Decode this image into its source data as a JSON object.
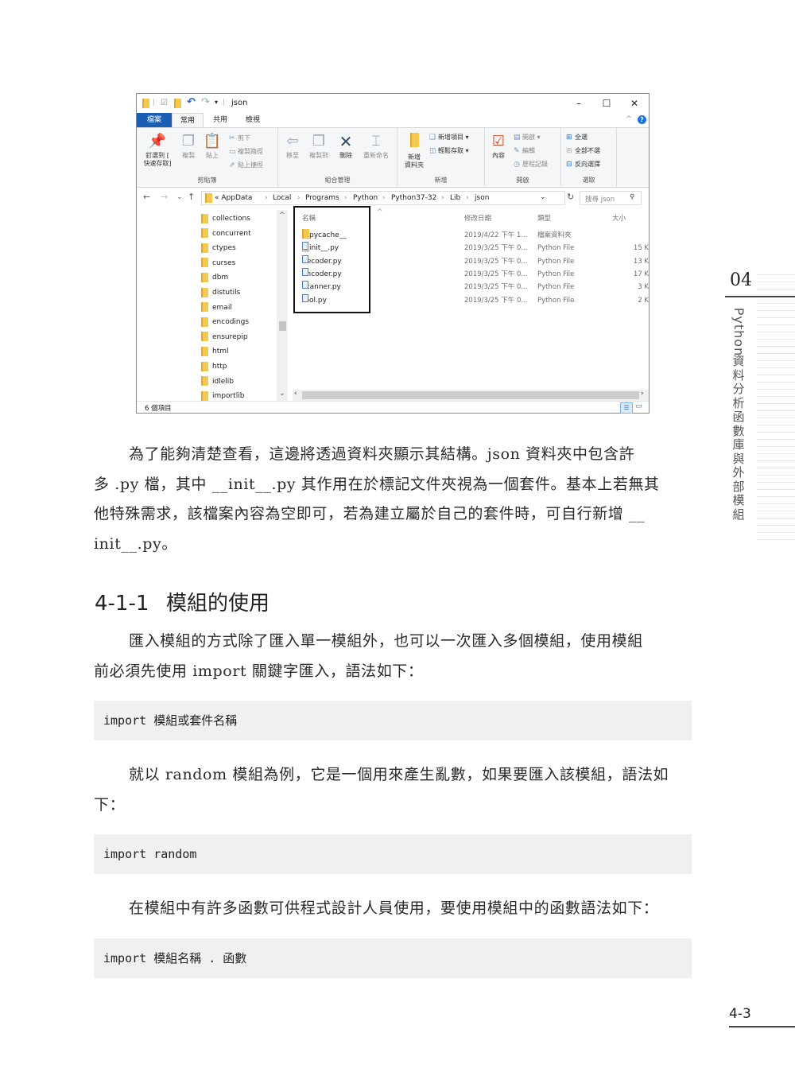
{
  "explorer": {
    "window_title": "json",
    "window_controls": {
      "minimize": "–",
      "maximize": "☐",
      "close": "✕"
    },
    "tabs": [
      {
        "label": "檔案",
        "active": false
      },
      {
        "label": "常用",
        "active": true
      },
      {
        "label": "共用",
        "active": false
      },
      {
        "label": "檢視",
        "active": false
      }
    ],
    "ribbon": {
      "clipboard": {
        "group_label": "剪貼簿",
        "pin_label_1": "釘選到 [",
        "pin_label_2": "快速存取]",
        "copy_label": "複製",
        "paste_label": "貼上",
        "cut_label": "剪下",
        "copy_path_label": "複製路徑",
        "paste_shortcut_label": "貼上捷徑"
      },
      "organize": {
        "group_label": "組合管理",
        "move_to_label": "移至",
        "copy_to_label": "複製到",
        "delete_label": "刪除",
        "rename_label": "重新命名"
      },
      "new": {
        "group_label": "新增",
        "new_folder_label_1": "新增",
        "new_folder_label_2": "資料夾",
        "new_item_label": "新增項目 ▾",
        "easy_access_label": "輕鬆存取 ▾"
      },
      "open": {
        "group_label": "開啟",
        "properties_label": "內容",
        "open_label": "開啟 ▾",
        "edit_label": "編輯",
        "history_label": "歷程記錄"
      },
      "select": {
        "group_label": "選取",
        "select_all_label": "全選",
        "select_none_label": "全部不選",
        "invert_label": "反向選擇"
      }
    },
    "nav": {
      "back": "←",
      "forward": "→",
      "recent": "⌄",
      "up": "↑",
      "breadcrumb": [
        "«  AppData",
        "Local",
        "Programs",
        "Python",
        "Python37-32",
        "Lib",
        "json"
      ],
      "separator": "›",
      "refresh": "↻",
      "dropdown": "⌄",
      "search_placeholder": "搜尋 json",
      "search_icon": "⚲"
    },
    "navpane_items": [
      "collections",
      "concurrent",
      "ctypes",
      "curses",
      "dbm",
      "distutils",
      "email",
      "encodings",
      "ensurepip",
      "html",
      "http",
      "idlelib",
      "importlib"
    ],
    "columns": {
      "name": "名稱",
      "modified": "修改日期",
      "type": "類型",
      "size": "大小"
    },
    "files": [
      {
        "name": "__pycache__",
        "kind": "folder",
        "modified": "2019/4/22 下午 1...",
        "type": "檔案資料夾",
        "size": ""
      },
      {
        "name": "__init__.py",
        "kind": "py",
        "modified": "2019/3/25 下午 0...",
        "type": "Python File",
        "size": "15 K"
      },
      {
        "name": "decoder.py",
        "kind": "py",
        "modified": "2019/3/25 下午 0...",
        "type": "Python File",
        "size": "13 K"
      },
      {
        "name": "encoder.py",
        "kind": "py",
        "modified": "2019/3/25 下午 0...",
        "type": "Python File",
        "size": "17 K"
      },
      {
        "name": "scanner.py",
        "kind": "py",
        "modified": "2019/3/25 下午 0...",
        "type": "Python File",
        "size": "3 K"
      },
      {
        "name": "tool.py",
        "kind": "py",
        "modified": "2019/3/25 下午 0...",
        "type": "Python File",
        "size": "2 K"
      }
    ],
    "status": "6 個項目"
  },
  "body": {
    "para1": "為了能夠清楚查看，這邊將透過資料夾顯示其結構。json 資料夾中包含許多 .py 檔，其中 __init__.py 其作用在於標記文件夾視為一個套件。基本上若無其他特殊需求，該檔案內容為空即可，若為建立屬於自己的套件時，可自行新增 __init__.py。",
    "para1_lines": [
      "為了能夠清楚查看，這邊將透過資料夾顯示其結構。json 資料夾中包含許",
      "多 .py 檔，其中 __init__.py 其作用在於標記文件夾視為一個套件。基本上若無其",
      "他特殊需求，該檔案內容為空即可，若為建立屬於自己的套件時，可自行新增 __",
      "init__.py。"
    ],
    "heading_number": "4-1-1",
    "heading_title": "模組的使用",
    "para2_lines": [
      "匯入模組的方式除了匯入單一模組外，也可以一次匯入多個模組，使用模組",
      "前必須先使用 import 關鍵字匯入，語法如下："
    ],
    "code1": "import 模組或套件名稱",
    "para3_lines": [
      "就以 random 模組為例，它是一個用來產生亂數，如果要匯入該模組，語法如",
      "下："
    ],
    "code2": "import random",
    "para4": "在模組中有許多函數可供程式設計人員使用，要使用模組中的函數語法如下：",
    "code3": "import 模組名稱 . 函數"
  },
  "side": {
    "chapter": "04",
    "title_latin": "Python",
    "title_cjk": [
      "資",
      "料",
      "分",
      "析",
      "函",
      "數",
      "庫",
      "與",
      "外",
      "部",
      "模",
      "組"
    ]
  },
  "page_number": "4-3"
}
